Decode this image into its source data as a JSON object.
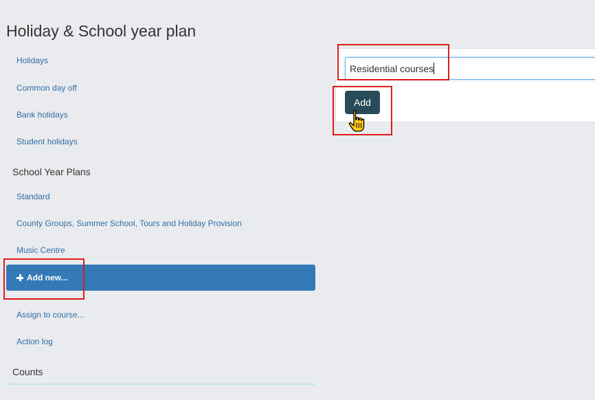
{
  "page": {
    "title": "Holiday & School year plan"
  },
  "sidebar": {
    "holiday_links": [
      {
        "label": "Holidays"
      },
      {
        "label": "Common day off"
      },
      {
        "label": "Bank holidays"
      },
      {
        "label": "Student holidays"
      }
    ],
    "school_year_plans_header": "School Year Plans",
    "plans": [
      {
        "label": "Standard"
      },
      {
        "label": "County Groups, Summer School, Tours and Holiday Provision"
      },
      {
        "label": "Music Centre"
      }
    ],
    "add_new_label": "Add new...",
    "actions": [
      {
        "label": "Assign to course..."
      },
      {
        "label": "Action log"
      }
    ],
    "counts_header": "Counts"
  },
  "form": {
    "name_value": "Residential courses",
    "add_button_label": "Add"
  },
  "colors": {
    "background": "#eaebee",
    "link": "#2f6ea5",
    "active_item": "#337ab7",
    "add_button": "#284b5a",
    "highlight": "#e01a1a"
  },
  "icons": {
    "add_new": "plus-icon",
    "cursor": "hand-pointer-icon"
  }
}
